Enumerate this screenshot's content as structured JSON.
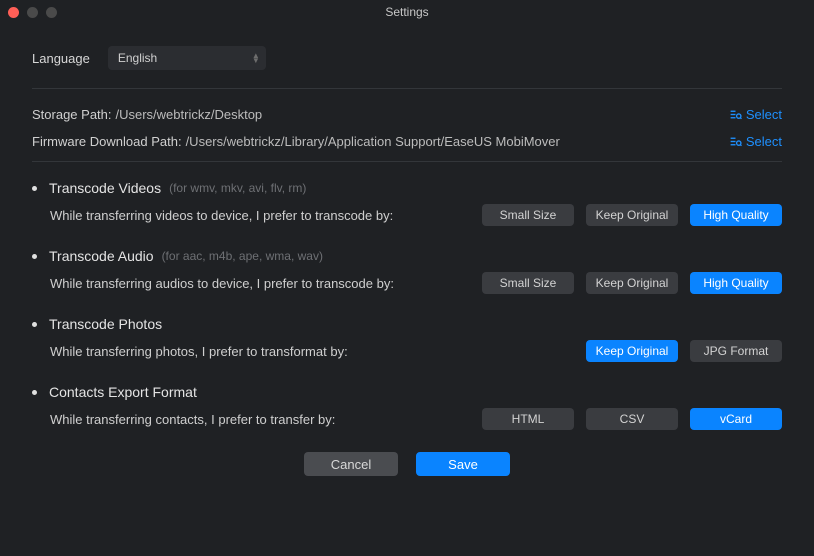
{
  "window": {
    "title": "Settings"
  },
  "language": {
    "label": "Language",
    "value": "English"
  },
  "paths": {
    "storage": {
      "label": "Storage Path:",
      "value": "/Users/webtrickz/Desktop",
      "select": "Select"
    },
    "firmware": {
      "label": "Firmware Download Path:",
      "value": "/Users/webtrickz/Library/Application Support/EaseUS MobiMover",
      "select": "Select"
    }
  },
  "sections": {
    "videos": {
      "title": "Transcode Videos",
      "hint": "(for wmv, mkv, avi, flv, rm)",
      "desc": "While transferring videos to device, I prefer to transcode by:",
      "options": {
        "small": "Small Size",
        "keep": "Keep Original",
        "hq": "High Quality"
      }
    },
    "audio": {
      "title": "Transcode Audio",
      "hint": "(for aac, m4b, ape, wma, wav)",
      "desc": "While transferring audios to device, I prefer to transcode by:",
      "options": {
        "small": "Small Size",
        "keep": "Keep Original",
        "hq": "High Quality"
      }
    },
    "photos": {
      "title": "Transcode Photos",
      "desc": "While transferring photos, I prefer to transformat by:",
      "options": {
        "keep": "Keep Original",
        "jpg": "JPG Format"
      }
    },
    "contacts": {
      "title": "Contacts Export Format",
      "desc": "While transferring contacts, I prefer to transfer by:",
      "options": {
        "html": "HTML",
        "csv": "CSV",
        "vcard": "vCard"
      }
    }
  },
  "footer": {
    "cancel": "Cancel",
    "save": "Save"
  }
}
